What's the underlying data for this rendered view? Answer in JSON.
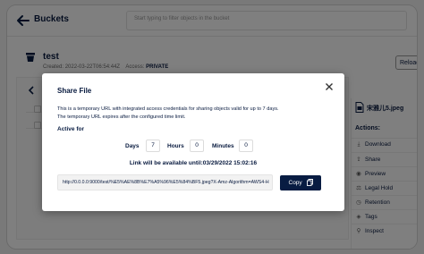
{
  "header": {
    "title": "Buckets",
    "search_placeholder": "Start typing to filter objects in the bucket"
  },
  "bucket": {
    "name": "test",
    "created_label": "Created:",
    "created_value": "2022-03-22T06:54:44Z",
    "access_label": "Access:",
    "access_value": "PRIVATE",
    "reload_label": "Reload"
  },
  "object_panel": {
    "file_name": "宋雅儿5.jpeg",
    "actions_label": "Actions:",
    "actions": [
      {
        "label": "Download",
        "icon": "download-icon"
      },
      {
        "label": "Share",
        "icon": "share-icon"
      },
      {
        "label": "Preview",
        "icon": "preview-icon"
      },
      {
        "label": "Legal Hold",
        "icon": "legal-hold-icon"
      },
      {
        "label": "Retention",
        "icon": "retention-icon"
      },
      {
        "label": "Tags",
        "icon": "tag-icon"
      },
      {
        "label": "Inspect",
        "icon": "inspect-icon"
      }
    ]
  },
  "modal": {
    "title": "Share File",
    "description_line1": "This is a temporary URL with integrated access credentials for sharing objects valid for up to 7 days.",
    "description_line2": "The temporary URL expires after the configured time limit.",
    "active_for_label": "Active for",
    "days_label": "Days",
    "days_value": "7",
    "hours_label": "Hours",
    "hours_value": "0",
    "minutes_label": "Minutes",
    "minutes_value": "0",
    "availability": "Link will be available until:03/29/2022 15:02:16",
    "url": "http://0.0.0.0:9000/test/%E5%AE%8B%E7%A5%96%E5%84%BF5.jpeg?X-Amz-Algorithm=AWS4-H",
    "copy_label": "Copy"
  },
  "colors": {
    "primary": "#081c42",
    "overlay": "rgba(0,0,0,0.5)"
  }
}
